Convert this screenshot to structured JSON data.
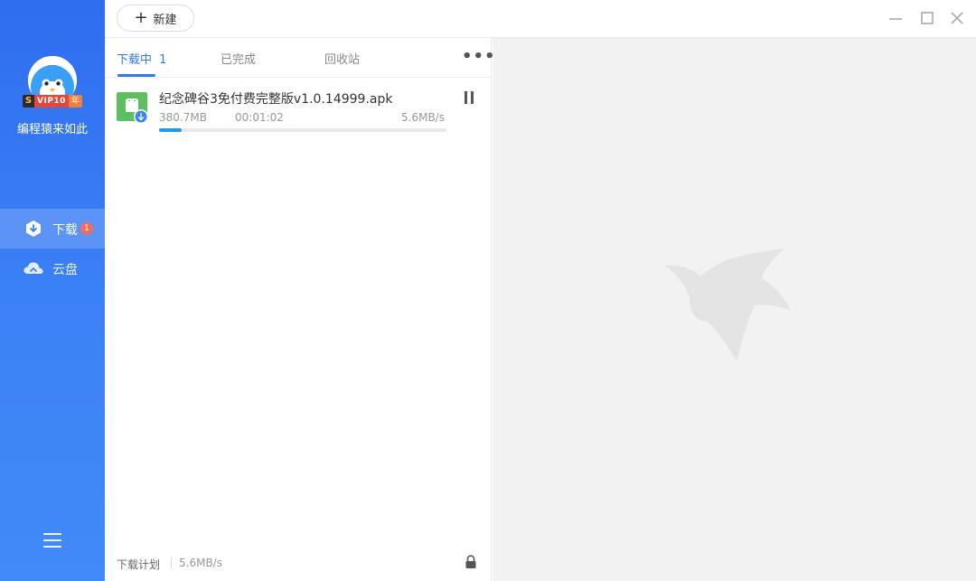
{
  "sidebar": {
    "vip": {
      "s": "S",
      "label": "VIP10",
      "year": "年"
    },
    "username": "编程猿来如此",
    "nav": [
      {
        "label": "下载",
        "badge": "1",
        "icon": "download-shield-icon",
        "active": true
      },
      {
        "label": "云盘",
        "icon": "cloud-icon",
        "active": false
      }
    ],
    "menu_icon": "hamburger-menu-icon"
  },
  "toolbar": {
    "new_label": "新建",
    "window_controls": [
      "minimize-icon",
      "maximize-icon",
      "close-icon"
    ]
  },
  "tabs": [
    {
      "label": "下载中",
      "count": "1",
      "active": true
    },
    {
      "label": "已完成",
      "active": false
    },
    {
      "label": "回收站",
      "active": false
    }
  ],
  "more_label": "•••",
  "downloads": [
    {
      "name": "纪念碑谷3免付费完整版v1.0.14999.apk",
      "size": "380.7MB",
      "time": "00:01:02",
      "speed": "5.6MB/s",
      "progress": 0.08
    }
  ],
  "footer": {
    "plan_label": "下载计划",
    "speed": "5.6MB/s"
  },
  "colors": {
    "sidebar": "#3b7ff5",
    "accent": "#2f7bf5",
    "progress": "#1f9af2",
    "badge": "#f26d5b"
  }
}
